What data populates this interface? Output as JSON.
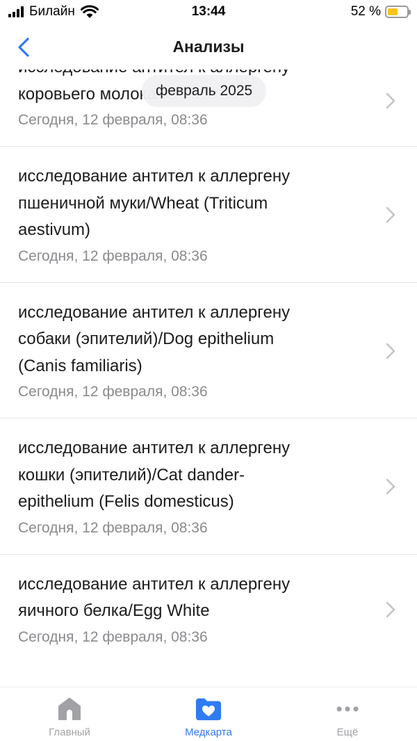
{
  "status_bar": {
    "carrier": "Билайн",
    "time": "13:44",
    "battery": "52 %",
    "battery_level": 0.52
  },
  "header": {
    "title": "Анализы"
  },
  "month_pill": "февраль 2025",
  "items": [
    {
      "title_lines": [
        "исследование антител к аллергену",
        "коровьего молока"
      ],
      "date": "Сегодня, 12 февраля, 08:36"
    },
    {
      "title_lines": [
        "исследование антител к аллергену",
        "пшеничной муки/Wheat (Triticum",
        "aestivum)"
      ],
      "date": "Сегодня, 12 февраля, 08:36"
    },
    {
      "title_lines": [
        "исследование антител к аллергену",
        "собаки (эпителий)/Dog epithelium",
        "(Canis familiaris)"
      ],
      "date": "Сегодня, 12 февраля, 08:36"
    },
    {
      "title_lines": [
        "исследование антител к аллергену",
        "кошки (эпителий)/Cat dander-",
        "epithelium (Felis domesticus)"
      ],
      "date": "Сегодня, 12 февраля, 08:36"
    },
    {
      "title_lines": [
        "исследование антител к аллергену",
        "яичного белка/Egg White"
      ],
      "date": "Сегодня, 12 февраля, 08:36"
    }
  ],
  "tabs": [
    {
      "label": "Главный",
      "icon": "home-icon",
      "active": false
    },
    {
      "label": "Медкарта",
      "icon": "heart-folder-icon",
      "active": true
    },
    {
      "label": "Ещё",
      "icon": "more-icon",
      "active": false
    }
  ],
  "colors": {
    "accent": "#2f7bf5",
    "inactive": "#a2a2a6",
    "secondary_text": "#8a8a8e",
    "battery": "#f5c518"
  }
}
